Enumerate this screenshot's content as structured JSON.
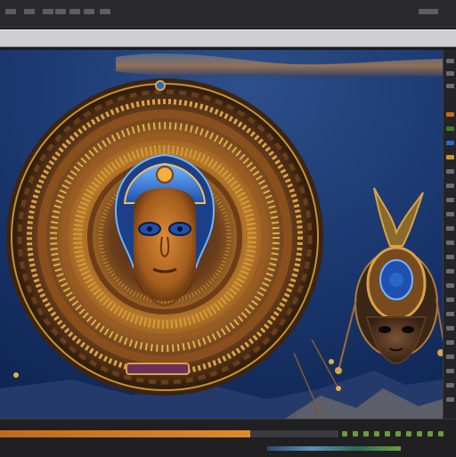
{
  "app": {
    "menu": {
      "items": [
        "",
        "",
        "",
        "",
        "",
        "",
        "",
        ""
      ]
    },
    "toolbar": {
      "label": ""
    }
  },
  "canvas": {
    "image": {
      "title": "",
      "subjects": [
        "sunburst-pharaoh-mask",
        "bird-crest-mask",
        "night-mountain-landscape"
      ],
      "colors": {
        "sky": "#16305f",
        "gold": "#c9922a",
        "bronze": "#7a4a1f",
        "lapis": "#2a66c9",
        "mountain": "#2a3b66"
      }
    }
  },
  "status": {
    "progress": 0.74,
    "accent": "#d07a22"
  }
}
